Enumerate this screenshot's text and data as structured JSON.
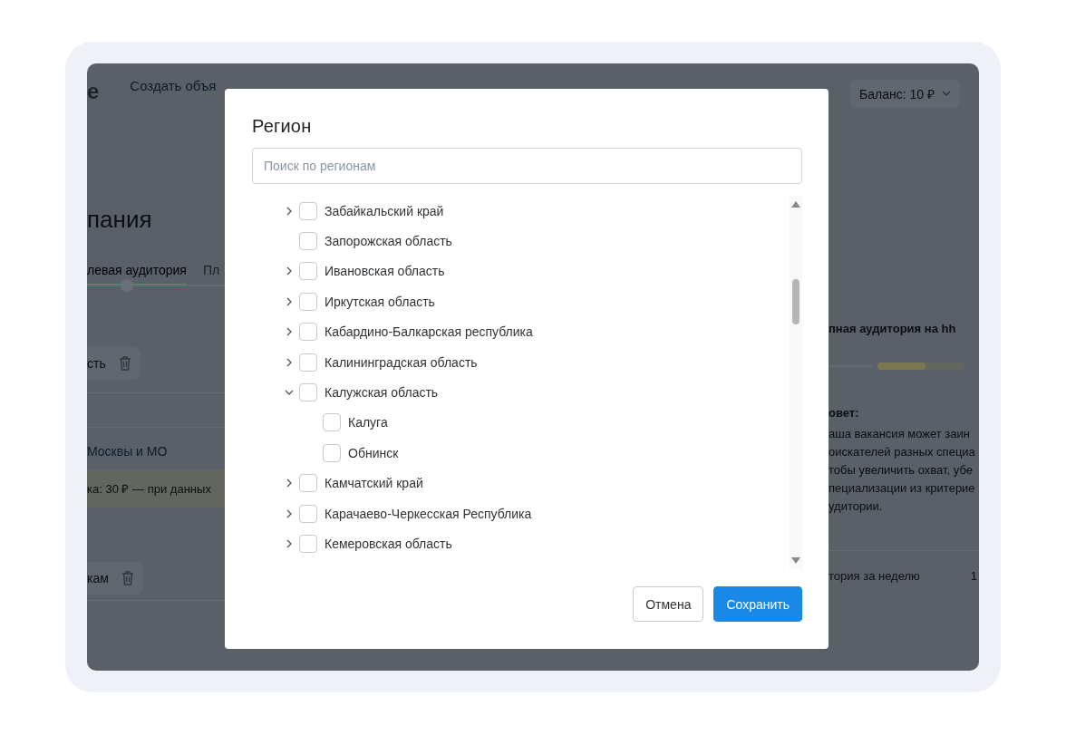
{
  "background": {
    "logo": "е",
    "nav_link": "Создать объя",
    "balance": "Баланс: 10 ₽",
    "heading": "пания",
    "tabs": [
      {
        "label": "левая аудитория",
        "selected": true
      },
      {
        "label": "Пл",
        "selected": false
      }
    ],
    "chips": [
      "сть",
      "кам"
    ],
    "region_link": "Москвы и МО",
    "price_note": "ка: 30 ₽ — при данных",
    "audience_title": "пная аудитория на hh",
    "audience_bar": {
      "level": 0.55
    },
    "tip_title": "овет:",
    "tip_text": "аша вакансия может заин\nоискателей разных специа\nтобы увеличить охват, убе\nпециализации из критерие\nудитории.",
    "week_label": "тория за неделю",
    "week_value": "1"
  },
  "dialog": {
    "title": "Регион",
    "search": {
      "placeholder": "Поиск по регионам"
    },
    "regions": [
      {
        "label": "Забайкальский край",
        "checked": false,
        "expanded": false
      },
      {
        "label": "Запорожская область",
        "checked": false
      },
      {
        "label": "Ивановская область",
        "checked": false,
        "expanded": false
      },
      {
        "label": "Иркутская область",
        "checked": false,
        "expanded": false
      },
      {
        "label": "Кабардино-Балкарская республика",
        "checked": false,
        "expanded": false
      },
      {
        "label": "Калининградская область",
        "checked": false,
        "expanded": false
      },
      {
        "label": "Калужская область",
        "checked": false,
        "expanded": true,
        "children": [
          {
            "label": "Калуга",
            "checked": false
          },
          {
            "label": "Обнинск",
            "checked": false
          }
        ]
      },
      {
        "label": "Камчатский край",
        "checked": false,
        "expanded": false
      },
      {
        "label": "Карачаево-Черкесская Республика",
        "checked": false,
        "expanded": false
      },
      {
        "label": "Кемеровская область",
        "checked": false,
        "expanded": false
      }
    ],
    "buttons": [
      {
        "label": "Отмена",
        "kind": "secondary"
      },
      {
        "label": "Сохранить",
        "kind": "primary"
      }
    ]
  }
}
